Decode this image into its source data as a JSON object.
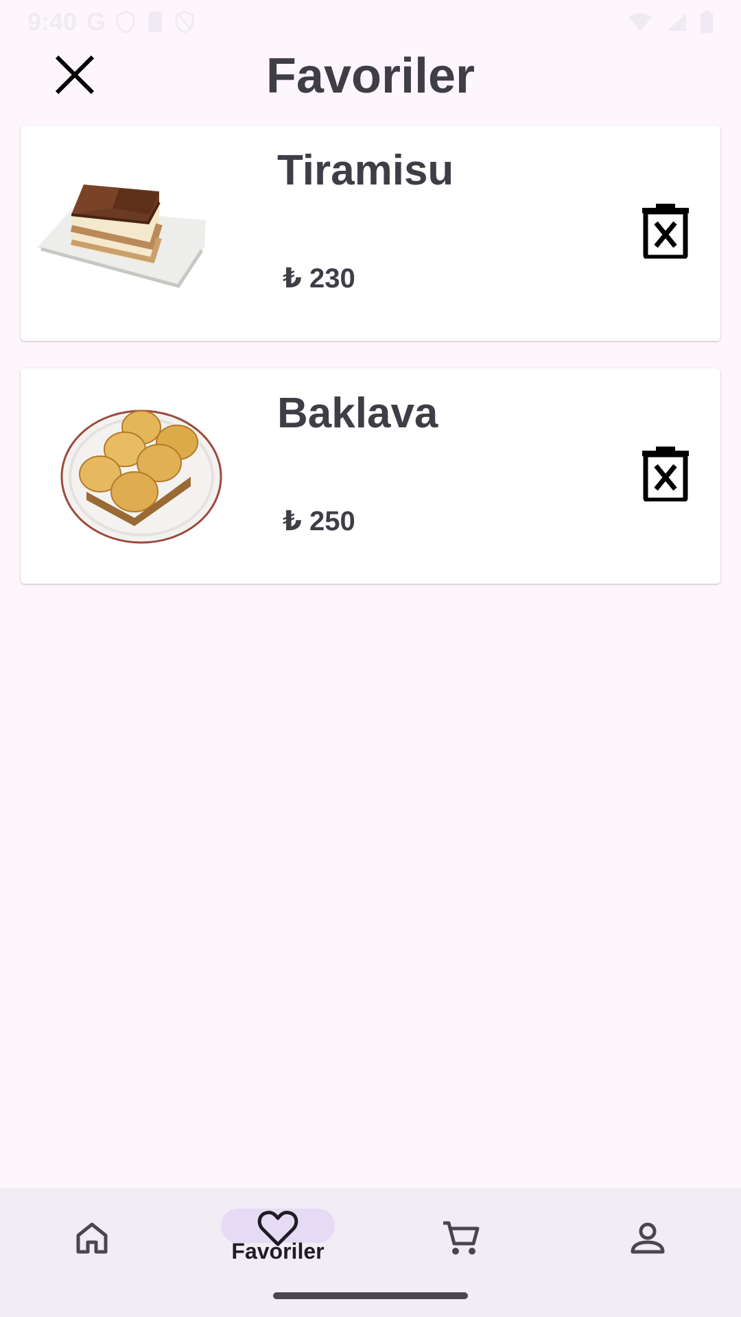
{
  "status_bar": {
    "time": "9:40",
    "network_label": "G",
    "icons": [
      "shield-icon",
      "sd-card-icon",
      "shield-off-icon",
      "wifi-icon",
      "signal-icon",
      "battery-icon"
    ]
  },
  "header": {
    "title": "Favoriler",
    "close_icon": "close-icon"
  },
  "favorites": [
    {
      "name": "Tiramisu",
      "price": "₺ 230",
      "image": "tiramisu-image",
      "delete_icon": "delete-icon"
    },
    {
      "name": "Baklava",
      "price": "₺ 250",
      "image": "baklava-image",
      "delete_icon": "delete-icon"
    }
  ],
  "bottom_nav": {
    "items": [
      {
        "icon": "home-icon",
        "label": ""
      },
      {
        "icon": "heart-icon",
        "label": "Favoriler",
        "selected": true
      },
      {
        "icon": "cart-icon",
        "label": ""
      },
      {
        "icon": "person-icon",
        "label": ""
      }
    ]
  },
  "colors": {
    "background": "#fdf7fd",
    "card": "#ffffff",
    "text": "#3f3d46",
    "nav_background": "#f2ecf5",
    "nav_selected_pill": "#e6dbf5"
  }
}
